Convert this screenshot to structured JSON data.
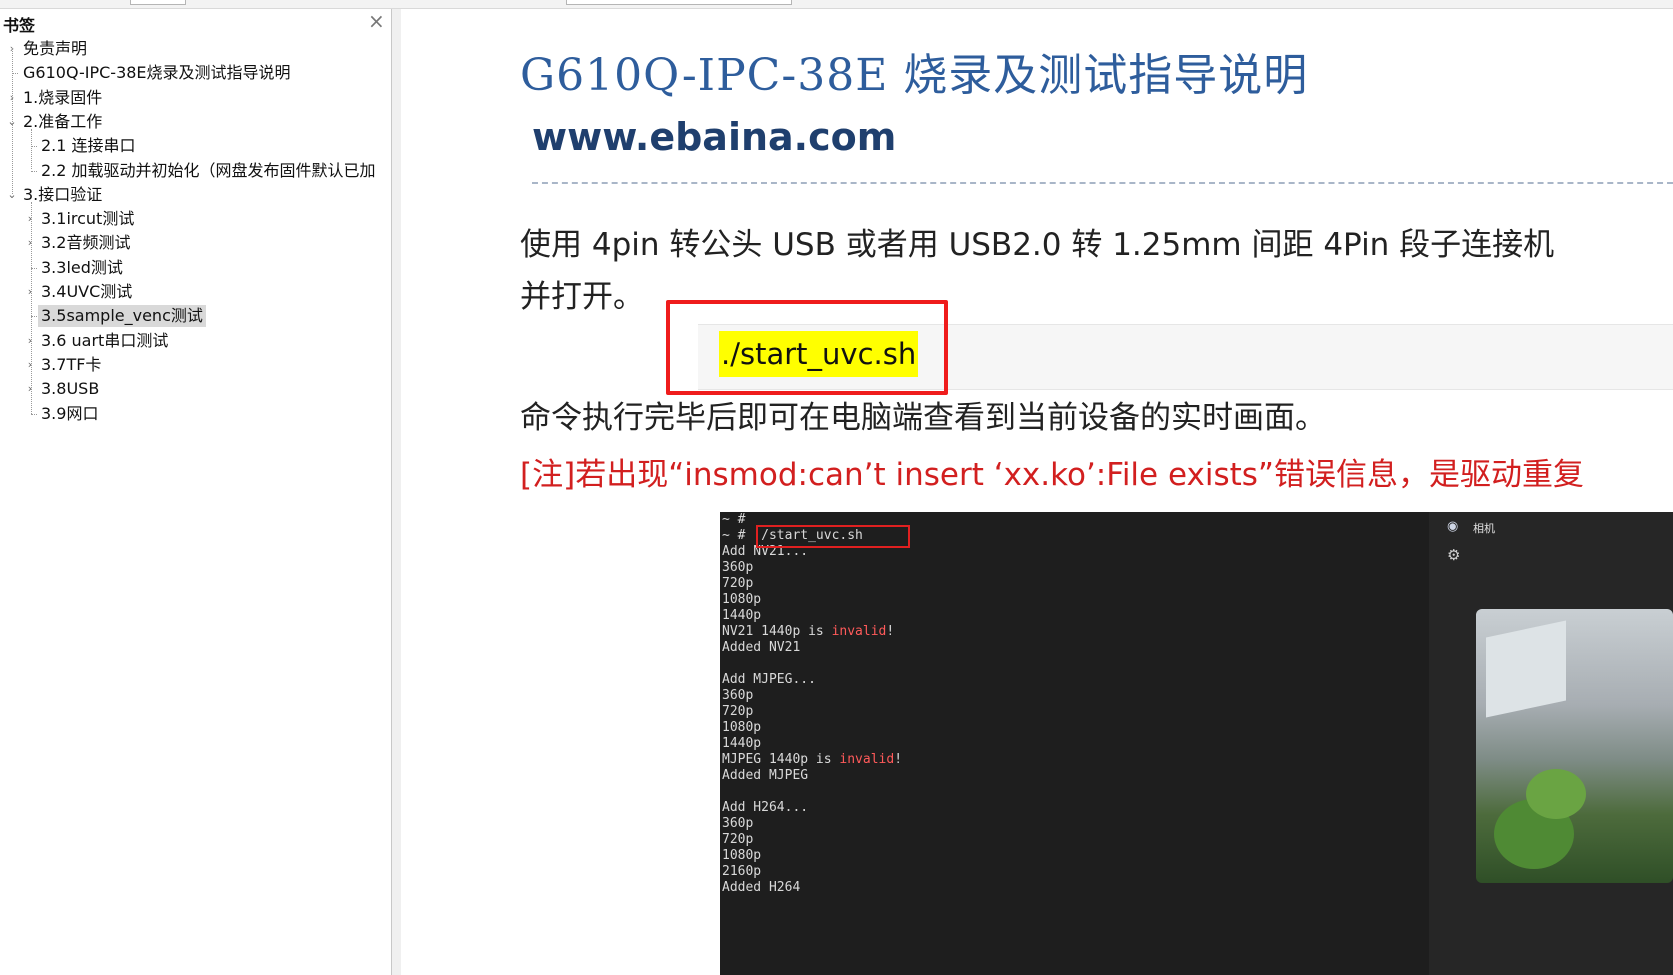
{
  "sidebar": {
    "title": "书签",
    "close_glyph": "×",
    "items": [
      {
        "label": "免责声明",
        "toggle": "›"
      },
      {
        "label": "G610Q-IPC-38E烧录及测试指导说明",
        "toggle": ""
      },
      {
        "label": "1.烧录固件",
        "toggle": "›"
      },
      {
        "label": "2.准备工作",
        "toggle": "⌄"
      },
      {
        "label": "2.1 连接串口",
        "toggle": ""
      },
      {
        "label": "2.2 加载驱动并初始化（网盘发布固件默认已加",
        "toggle": ""
      },
      {
        "label": "3.接口验证",
        "toggle": "⌄"
      },
      {
        "label": "3.1ircut测试",
        "toggle": "›"
      },
      {
        "label": "3.2音频测试",
        "toggle": "›"
      },
      {
        "label": "3.3led测试",
        "toggle": ""
      },
      {
        "label": "3.4UVC测试",
        "toggle": "›"
      },
      {
        "label": "3.5sample_venc测试",
        "toggle": "",
        "selected": true
      },
      {
        "label": "3.6 uart串口测试",
        "toggle": "›"
      },
      {
        "label": "3.7TF卡",
        "toggle": "›"
      },
      {
        "label": "3.8USB",
        "toggle": "›"
      },
      {
        "label": "3.9网口",
        "toggle": ""
      }
    ]
  },
  "document": {
    "title": "G610Q-IPC-38E 烧录及测试指导说明",
    "url": "www.ebaina.com",
    "para_line1": "使用 4pin 转公头 USB 或者用 USB2.0 转 1.25mm 间距 4Pin 段子连接机",
    "para_line2": "并打开。",
    "code": "./start_uvc.sh",
    "result_line": "命令执行完毕后即可在电脑端查看到当前设备的实时画面。",
    "note": "[注]若出现“insmod:can’t insert ‘xx.ko’:File exists”错误信息，是驱动重复"
  },
  "terminal": {
    "lines": [
      {
        "text": "~ #"
      },
      {
        "text": "~ # ./start_uvc.sh"
      },
      {
        "text": "Add NV21..."
      },
      {
        "text": "360p"
      },
      {
        "text": "720p"
      },
      {
        "text": "1080p"
      },
      {
        "text": "1440p"
      },
      {
        "text": "NV21 1440p is ",
        "inv": "invalid",
        "tail": "!"
      },
      {
        "text": "Added NV21"
      },
      {
        "text": ""
      },
      {
        "text": "Add MJPEG..."
      },
      {
        "text": "360p"
      },
      {
        "text": "720p"
      },
      {
        "text": "1080p"
      },
      {
        "text": "1440p"
      },
      {
        "text": "MJPEG 1440p is ",
        "inv": "invalid",
        "tail": "!"
      },
      {
        "text": "Added MJPEG"
      },
      {
        "text": ""
      },
      {
        "text": "Add H264..."
      },
      {
        "text": "360p"
      },
      {
        "text": "720p"
      },
      {
        "text": "1080p"
      },
      {
        "text": "2160p"
      },
      {
        "text": "Added H264"
      }
    ],
    "camera_app_label": "相机",
    "camera_icon": "camera-icon",
    "settings_icon": "gear-icon"
  },
  "colors": {
    "title_blue": "#2e5d9c",
    "note_red": "#d21f1f",
    "highlight_yellow": "#ffff00",
    "box_red": "#ef1c1c"
  }
}
